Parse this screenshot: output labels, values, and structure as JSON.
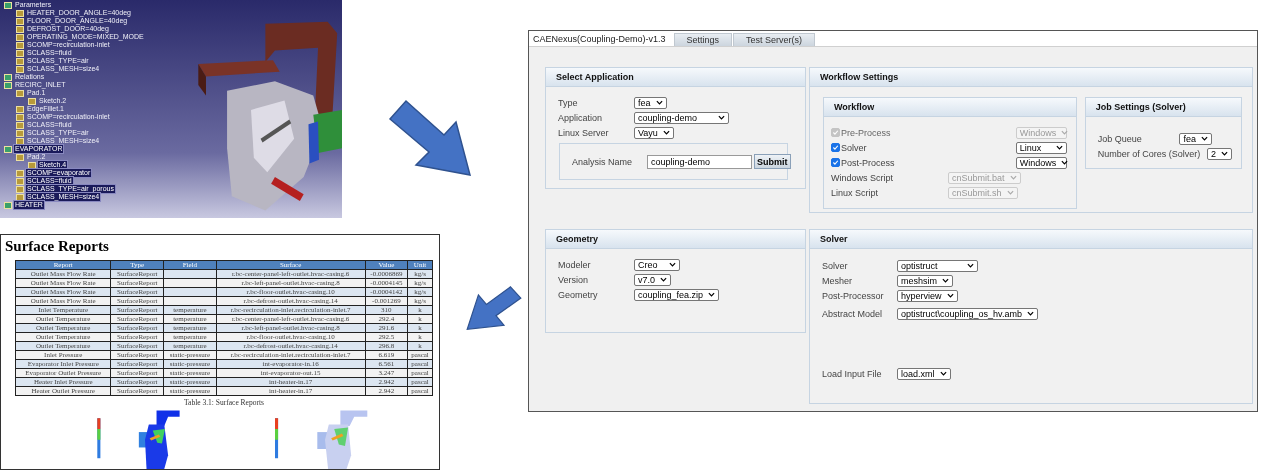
{
  "cad_window": {
    "tree": [
      {
        "label": "Parameters",
        "selected": false,
        "children": [
          {
            "label": "HEATER_DOOR_ANGLE=40deg",
            "selected": false
          },
          {
            "label": "FLOOR_DOOR_ANGLE=40deg",
            "selected": false
          },
          {
            "label": "DEFROST_DOOR=40deg",
            "selected": false
          },
          {
            "label": "OPERATING_MODE=MIXED_MODE",
            "selected": false
          },
          {
            "label": "SCOMP=recirculation-inlet",
            "selected": false
          },
          {
            "label": "SCLASS=fluid",
            "selected": false
          },
          {
            "label": "SCLASS_TYPE=air",
            "selected": false
          },
          {
            "label": "SCLASS_MESH=size4",
            "selected": false
          }
        ]
      },
      {
        "label": "Relations",
        "selected": false
      },
      {
        "label": "RECIRC_INLET",
        "selected": false,
        "children": [
          {
            "label": "Pad.1",
            "selected": false,
            "children": [
              {
                "label": "Sketch.2",
                "selected": false
              }
            ]
          },
          {
            "label": "EdgeFillet.1",
            "selected": false
          },
          {
            "label": "SCOMP=recirculation-inlet",
            "selected": false
          },
          {
            "label": "SCLASS=fluid",
            "selected": false
          },
          {
            "label": "SCLASS_TYPE=air",
            "selected": false
          },
          {
            "label": "SCLASS_MESH=size4",
            "selected": false
          }
        ]
      },
      {
        "label": "EVAPORATOR",
        "selected": true,
        "children": [
          {
            "label": "Pad.2",
            "selected": false,
            "children": [
              {
                "label": "Sketch.4",
                "selected": true
              }
            ]
          },
          {
            "label": "SCOMP=evaporator",
            "selected": true
          },
          {
            "label": "SCLASS=fluid",
            "selected": true
          },
          {
            "label": "SCLASS_TYPE=air_porous",
            "selected": true
          },
          {
            "label": "SCLASS_MESH=size4",
            "selected": true
          }
        ]
      },
      {
        "label": "HEATER",
        "selected": true
      }
    ]
  },
  "report_page": {
    "title": "Surface Reports",
    "table": {
      "columns": [
        "Report",
        "Type",
        "Field",
        "Surface",
        "Value",
        "Unit"
      ],
      "rows": [
        [
          "Outlet Mass Flow Rate",
          "SurfaceReport",
          "",
          "r.bc-center-panel-left-outlet.hvac-casing.6",
          "-0.0006869",
          "kg/s"
        ],
        [
          "Outlet Mass Flow Rate",
          "SurfaceReport",
          "",
          "r.bc-left-panel-outlet.hvac-casing.8",
          "-0.0004145",
          "kg/s"
        ],
        [
          "Outlet Mass Flow Rate",
          "SurfaceReport",
          "",
          "r.bc-floor-outlet.hvac-casing.10",
          "-0.0004142",
          "kg/s"
        ],
        [
          "Outlet Mass Flow Rate",
          "SurfaceReport",
          "",
          "r.bc-defrost-outlet.hvac-casing.14",
          "-0.001269",
          "kg/s"
        ],
        [
          "Inlet Temperature",
          "SurfaceReport",
          "temperature",
          "r.bc-recirculation-inlet.recirculation-inlet.7",
          "310",
          "k"
        ],
        [
          "Outlet Temperature",
          "SurfaceReport",
          "temperature",
          "r.bc-center-panel-left-outlet.hvac-casing.6",
          "292.4",
          "k"
        ],
        [
          "Outlet Temperature",
          "SurfaceReport",
          "temperature",
          "r.bc-left-panel-outlet.hvac-casing.8",
          "291.6",
          "k"
        ],
        [
          "Outlet Temperature",
          "SurfaceReport",
          "temperature",
          "r.bc-floor-outlet.hvac-casing.10",
          "292.5",
          "k"
        ],
        [
          "Outlet Temperature",
          "SurfaceReport",
          "temperature",
          "r.bc-defrost-outlet.hvac-casing.14",
          "296.8",
          "k"
        ],
        [
          "Inlet Pressure",
          "SurfaceReport",
          "static-pressure",
          "r.bc-recirculation-inlet.recirculation-inlet.7",
          "6.619",
          "pascal"
        ],
        [
          "Evaporator Inlet Pressure",
          "SurfaceReport",
          "static-pressure",
          "int-evaporator-in.16",
          "6.561",
          "pascal"
        ],
        [
          "Evaporator Outlet Pressure",
          "SurfaceReport",
          "static-pressure",
          "int-evaporator-out.15",
          "3.247",
          "pascal"
        ],
        [
          "Heater Inlet Pressure",
          "SurfaceReport",
          "static-pressure",
          "int-heater-in.17",
          "2.942",
          "pascal"
        ],
        [
          "Heater Outlet Pressure",
          "SurfaceReport",
          "static-pressure",
          "int-heater-in.17",
          "2.942",
          "pascal"
        ]
      ]
    },
    "caption": "Table 3.1: Surface Reports"
  },
  "app": {
    "tabs": [
      {
        "label": "CAENexus(Coupling-Demo)-v1.3",
        "selected": true
      },
      {
        "label": "Settings",
        "selected": false
      },
      {
        "label": "Test Server(s)",
        "selected": false
      }
    ],
    "select_application": {
      "title": "Select Application",
      "fields": [
        {
          "label": "Type",
          "value": "fea"
        },
        {
          "label": "Application",
          "value": "coupling-demo"
        },
        {
          "label": "Linux Server",
          "value": "Vayu"
        }
      ],
      "analysis": {
        "label": "Analysis Name",
        "value": "coupling-demo",
        "button": "Submit"
      }
    },
    "workflow_settings": {
      "title": "Workflow Settings",
      "workflow": {
        "title": "Workflow",
        "steps": [
          {
            "label": "Pre-Process",
            "checked": true,
            "disabled": true,
            "target": "Windows"
          },
          {
            "label": "Solver",
            "checked": true,
            "disabled": false,
            "target": "Linux"
          },
          {
            "label": "Post-Process",
            "checked": true,
            "disabled": false,
            "target": "Windows"
          }
        ],
        "scripts": [
          {
            "label": "Windows Script",
            "value": "cnSubmit.bat",
            "disabled": true
          },
          {
            "label": "Linux Script",
            "value": "cnSubmit.sh",
            "disabled": true
          }
        ]
      },
      "job": {
        "title": "Job Settings (Solver)",
        "fields": [
          {
            "label": "Job Queue",
            "value": "fea"
          },
          {
            "label": "Number of Cores (Solver)",
            "value": "2"
          }
        ]
      }
    },
    "geometry": {
      "title": "Geometry",
      "fields": [
        {
          "label": "Modeler",
          "value": "Creo"
        },
        {
          "label": "Version",
          "value": "v7.0"
        },
        {
          "label": "Geometry",
          "value": "coupling_fea.zip"
        }
      ]
    },
    "solver": {
      "title": "Solver",
      "fields": [
        {
          "label": "Solver",
          "value": "optistruct"
        },
        {
          "label": "Mesher",
          "value": "meshsim"
        },
        {
          "label": "Post-Processor",
          "value": "hyperview"
        },
        {
          "label": "Abstract Model",
          "value": "optistruct\\coupling_os_hv.amb"
        }
      ],
      "load": {
        "label": "Load Input File",
        "value": "load.xml"
      }
    }
  }
}
